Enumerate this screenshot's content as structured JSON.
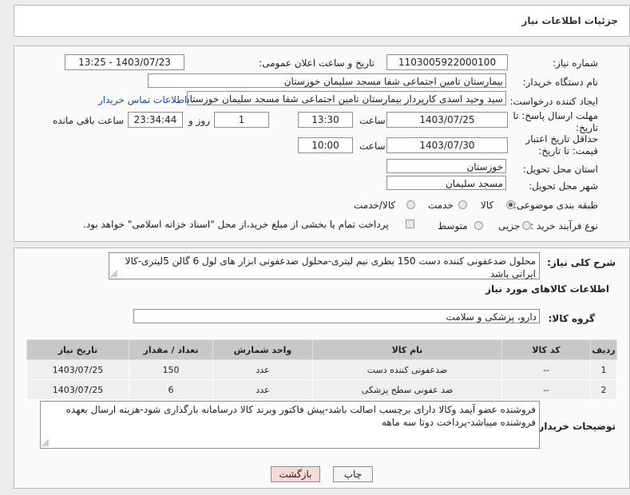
{
  "header": {
    "title": "جزئیات اطلاعات نیاز"
  },
  "form": {
    "need_number_label": "شماره نیاز:",
    "need_number": "1103005922000100",
    "announce_label": "تاریخ و ساعت اعلان عمومی:",
    "announce_value": "1403/07/23 - 13:25",
    "buyer_org_label": "نام دستگاه خریدار:",
    "buyer_org": "بیمارستان تامین اجتماعی شفا مسجد سلیمان خوزستان",
    "creator_label": "ایجاد کننده درخواست:",
    "creator": "سید وحید اسدی کارپرداز بیمارستان تامین اجتماعی شفا مسجد سلیمان خوزستان",
    "contact_link": "اطلاعات تماس خریدار",
    "send_deadline_label": "مهلت ارسال پاسخ: تا تاریخ:",
    "send_deadline_date": "1403/07/25",
    "time_label": "ساعت",
    "send_deadline_time": "13:30",
    "days_value": "1",
    "days_label": "روز و",
    "remaining_time": "23:34:44",
    "remaining_label": "ساعت باقی مانده",
    "validity_label": "حداقل تاریخ اعتبار قیمت: تا تاریخ:",
    "validity_date": "1403/07/30",
    "validity_time_label": "ساعت",
    "validity_time": "10:00",
    "province_label": "استان محل تحویل:",
    "province": "خوزستان",
    "city_label": "شهر محل تحویل:",
    "city": "مسجد سلیمان",
    "category_label": "طبقه بندی موضوعی:",
    "category_options": [
      "کالا",
      "خدمت",
      "کالا/خدمت"
    ],
    "category_selected": "کالا",
    "process_label": "نوع فرآیند خرید :",
    "process_options": [
      "جزیی",
      "متوسط"
    ],
    "process_note": "پرداخت تمام یا بخشی از مبلغ خرید،از محل \"اسناد خزانه اسلامی\" خواهد بود."
  },
  "description": {
    "label": "شرح کلی نیاز:",
    "text": "محلول ضدعفونی کننده دست 150 بطری نیم لیتری-محلول ضدعفونی ابزار های لول 6 گالن 5لیتری-کالا ایرانی باشد"
  },
  "goods": {
    "section_title": "اطلاعات کالاهای مورد نیاز",
    "group_label": "گروه کالا:",
    "group_value": "دارو، پزشکی و سلامت",
    "columns": [
      "ردیف",
      "کد کالا",
      "نام کالا",
      "واحد شمارش",
      "تعداد / مقدار",
      "تاریخ نیاز"
    ],
    "rows": [
      [
        "1",
        "--",
        "ضدعفونی کننده دست",
        "عدد",
        "150",
        "1403/07/25"
      ],
      [
        "2",
        "--",
        "ضد عفونی سطح پزشکی",
        "عدد",
        "6",
        "1403/07/25"
      ]
    ]
  },
  "buyer_notes": {
    "label": "توضیحات خریدار:",
    "text": "فروشنده عضو آیمد وکالا دارای برچسب اصالت باشد-پیش فاکتور وبرند کالا درسامانه بارگذاری شود-هزینه ارسال بعهده فروشنده میباشد-پرداخت دوتا سه ماهه"
  },
  "buttons": {
    "print": "چاپ",
    "back": "بازگشت"
  },
  "colors": {
    "link": "#1a4fb5",
    "back_button_bg": "#f6d9d9"
  }
}
